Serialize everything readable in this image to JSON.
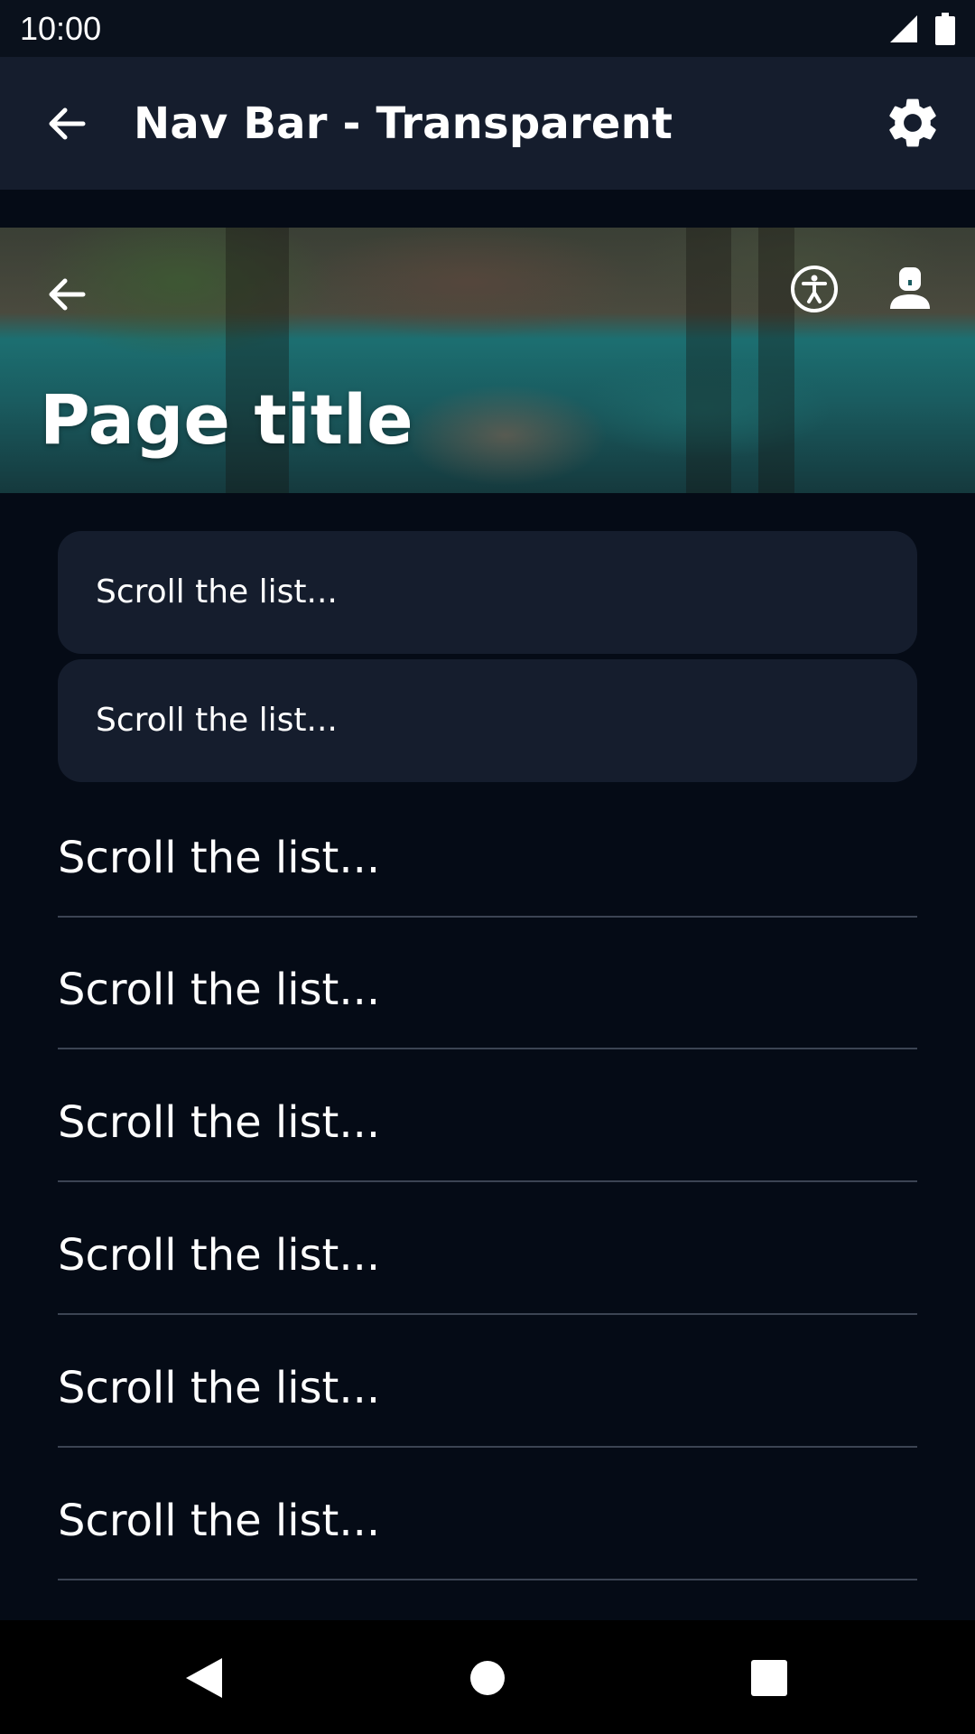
{
  "status_bar": {
    "time": "10:00",
    "icons": [
      "signal-icon",
      "battery-icon"
    ]
  },
  "app_bar": {
    "title": "Nav Bar - Transparent",
    "icons": [
      "back-arrow-icon",
      "gear-icon"
    ]
  },
  "hero": {
    "page_title": "Page title",
    "icons": [
      "back-arrow-icon",
      "accessibility-icon",
      "user-icon"
    ]
  },
  "list": {
    "cards": [
      {
        "label": "Scroll the list..."
      },
      {
        "label": "Scroll the list..."
      }
    ],
    "rows": [
      {
        "label": "Scroll the list..."
      },
      {
        "label": "Scroll the list..."
      },
      {
        "label": "Scroll the list..."
      },
      {
        "label": "Scroll the list..."
      },
      {
        "label": "Scroll the list..."
      },
      {
        "label": "Scroll the list..."
      }
    ]
  },
  "system_nav": {
    "icons": [
      "back-triangle-icon",
      "home-circle-icon",
      "recents-square-icon"
    ]
  },
  "colors": {
    "background": "#050b16",
    "app_bar": "#151d2d",
    "card": "#151d2d",
    "divider": "#3c4453",
    "text": "#ffffff"
  }
}
